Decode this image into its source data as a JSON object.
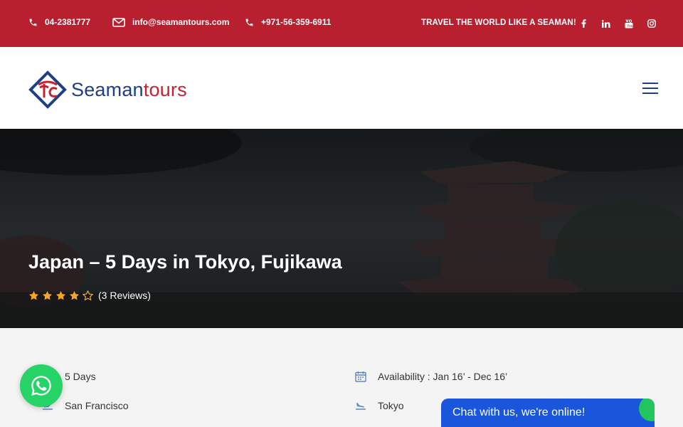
{
  "topbar": {
    "phone": "04-2381777",
    "email": "info@seamantours.com",
    "mobile": "+971-56-359-6911",
    "slogan": "TRAVEL THE WORLD LIKE A SEAMAN!",
    "social": [
      "facebook-icon",
      "linkedin-icon",
      "youtube-icon",
      "instagram-icon"
    ],
    "bg_color": "#b8202f"
  },
  "header": {
    "logo_part1": "Seaman",
    "logo_part2": "tours",
    "brand_blue": "#1e3f85",
    "brand_red": "#c8202f"
  },
  "hero": {
    "title": "Japan – 5 Days in Tokyo, Fujikawa",
    "rating": 4,
    "rating_max": 5,
    "reviews": "(3 Reviews)"
  },
  "info": {
    "duration": "5 Days",
    "availability": "Availability : Jan 16’ - Dec 16’",
    "departure": "San Francisco",
    "arrival": "Tokyo"
  },
  "chat": {
    "label": "Chat with us, we're online!"
  }
}
